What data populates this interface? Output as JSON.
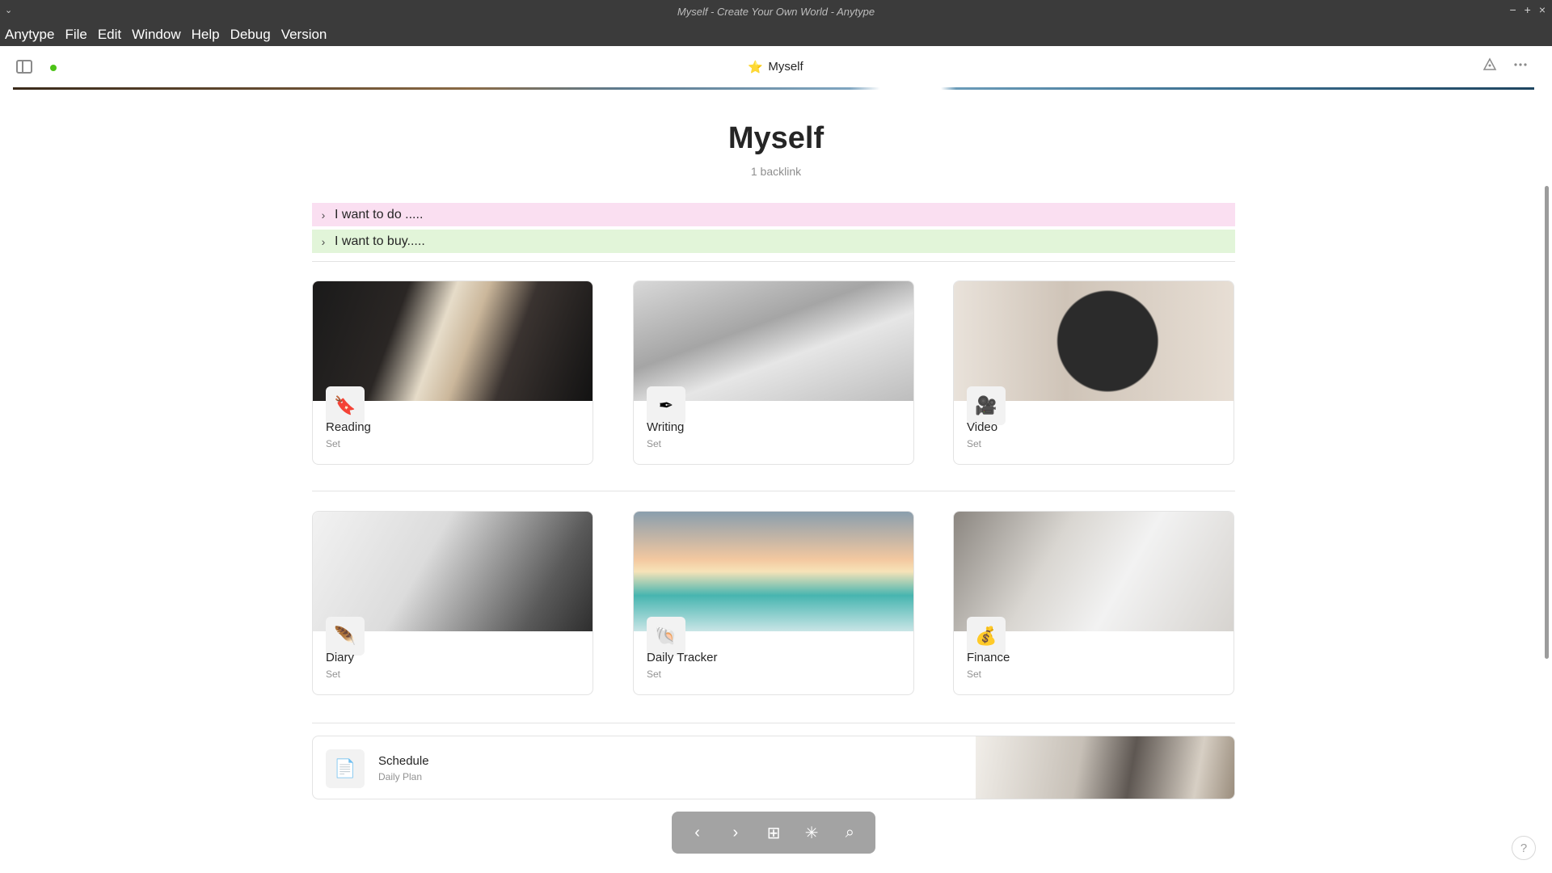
{
  "window": {
    "title": "Myself - Create Your Own World - Anytype",
    "wm_menu_glyph": "⌄",
    "wm_controls": [
      "−",
      "+",
      "×"
    ]
  },
  "menubar": [
    "Anytype",
    "File",
    "Edit",
    "Window",
    "Help",
    "Debug",
    "Version"
  ],
  "header": {
    "breadcrumb_label": "Myself",
    "breadcrumb_icon": "⭐",
    "sync_status_color": "#4cc317"
  },
  "document": {
    "title": "Myself",
    "backlinks": "1 backlink"
  },
  "toggles": [
    {
      "label": "I want to do .....",
      "color": "#fadff1"
    },
    {
      "label": "I want to buy.....",
      "color": "#e2f5d9"
    }
  ],
  "cards": [
    {
      "name": "Reading",
      "type": "Set",
      "icon": "🔖"
    },
    {
      "name": "Writing",
      "type": "Set",
      "icon": "✒"
    },
    {
      "name": "Video",
      "type": "Set",
      "icon": "🎥"
    },
    {
      "name": "Diary",
      "type": "Set",
      "icon": "🪶"
    },
    {
      "name": "Daily Tracker",
      "type": "Set",
      "icon": "🐚"
    },
    {
      "name": "Finance",
      "type": "Set",
      "icon": "💰"
    }
  ],
  "schedule": {
    "name": "Schedule",
    "type": "Daily Plan",
    "icon": "📄"
  },
  "navbar": {
    "back": "‹",
    "forward": "›",
    "plus": "⊞",
    "graph": "✳",
    "search": "⌕"
  },
  "help_label": "?"
}
